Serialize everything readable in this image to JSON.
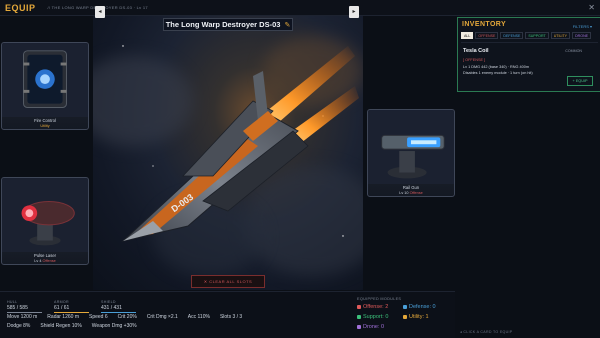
{
  "header": {
    "title": "EQUIP",
    "breadcrumb": "// THE LONG WARP DESTROYER DS-03 · Lv 17",
    "close_label": "✕"
  },
  "stage": {
    "ship_name": "The Long Warp Destroyer DS-03",
    "edit_icon": "pencil-icon",
    "prev_label": "◂",
    "next_label": "▸",
    "clear_label": "✕ CLEAR ALL SLOTS",
    "hull_marking": "D-003"
  },
  "modules": {
    "fire_control": {
      "name": "Fire Control",
      "tag": "Utility",
      "color": "#e4a83a"
    },
    "pulse_laser": {
      "name": "Pulse Laser",
      "level": "Lv 4",
      "tag": "Offense",
      "color": "#d0575a"
    },
    "rail_gun": {
      "name": "Rail Gun",
      "level": "Lv 10",
      "tag": "Offense",
      "color": "#d0575a"
    }
  },
  "inventory": {
    "title": "INVENTORY",
    "filters_label": "FILTERS ▾",
    "tabs": [
      "ALL",
      "OFFENSE",
      "DEFENSE",
      "SUPPORT",
      "UTILITY",
      "DRONE"
    ],
    "active_tab": "ALL",
    "item": {
      "name": "Tesla Coil",
      "rarity": "COMMON",
      "type": "[ OFFENSE ]",
      "stats": "Lv 1   DMG 442 (base 340) · RNG 400m",
      "desc": "Disables 1 enemy module · 1 turn (on hit)",
      "equip_label": "+ EQUIP"
    },
    "hint": "◂ CLICK A CARD TO EQUIP"
  },
  "stats": {
    "hull": {
      "label": "HULL",
      "value": "585 / 585",
      "color": "#7c8594"
    },
    "armor": {
      "label": "ARMOR",
      "value": "61 / 61",
      "color": "#e4a83a"
    },
    "shield": {
      "label": "SHIELD",
      "value": "431 / 431",
      "color": "#4a9fd8"
    },
    "row1": [
      "Move 1200 m",
      "Radar 1260 m",
      "Speed 6",
      "Crit 20%",
      "Crit Dmg ×2.1",
      "Acc 110%",
      "Slots 3 / 3"
    ],
    "row2": [
      "Dodge 8%",
      "Shield Regen 10%",
      "Weapon Dmg +30%"
    ]
  },
  "equipped": {
    "label": "EQUIPPED MODULES",
    "offense": {
      "label": "Offense: 2",
      "color": "#e05a5a"
    },
    "defense": {
      "label": "Defense: 0",
      "color": "#4a9fd8"
    },
    "support": {
      "label": "Support: 0",
      "color": "#3cc07a"
    },
    "utility": {
      "label": "Utility: 1",
      "color": "#e4a83a"
    },
    "drone": {
      "label": "Drone: 0",
      "color": "#a070d8"
    }
  }
}
